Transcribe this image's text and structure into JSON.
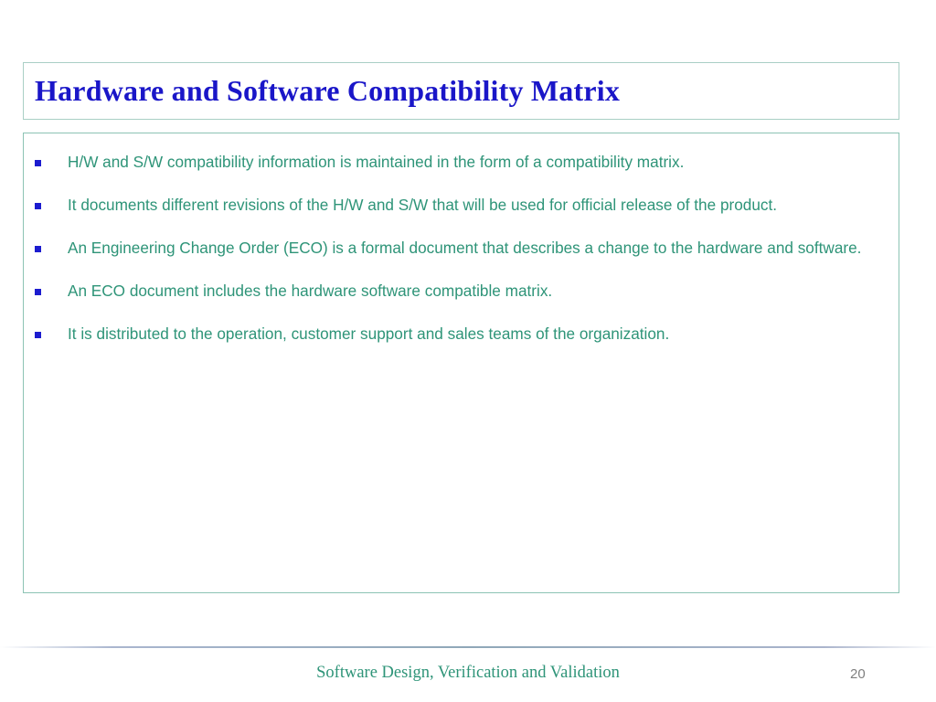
{
  "slide": {
    "title": "Hardware and Software Compatibility Matrix",
    "bullets": [
      {
        "text": "H/W and S/W compatibility information is maintained in the form of a compatibility matrix.",
        "marker": "square-bullet"
      },
      {
        "text": "It documents different revisions of the H/W and S/W that will be used for official release of the product.",
        "marker": "square-bullet"
      },
      {
        "text": "An Engineering Change Order (ECO) is a formal document that describes a change to the hardware and software.",
        "marker": "square-bullet"
      },
      {
        "text": "An ECO document includes the hardware software compatible matrix.",
        "marker": "square-bullet"
      },
      {
        "text": "It is distributed to the operation, customer support and sales teams of the organization.",
        "marker": "square-bullet"
      }
    ],
    "footer": {
      "label": "Software Design, Verification and Validation",
      "page_number": "20"
    },
    "colors": {
      "title_text": "#1a16c8",
      "body_text": "#2e9478",
      "bullet_marker": "#1c1ccf",
      "box_border": "#8cc3b4",
      "title_box_border": "#a9cfc5",
      "footer_text": "#2e9478",
      "page_number_text": "#7f7f7f",
      "background": "#ffffff"
    }
  }
}
